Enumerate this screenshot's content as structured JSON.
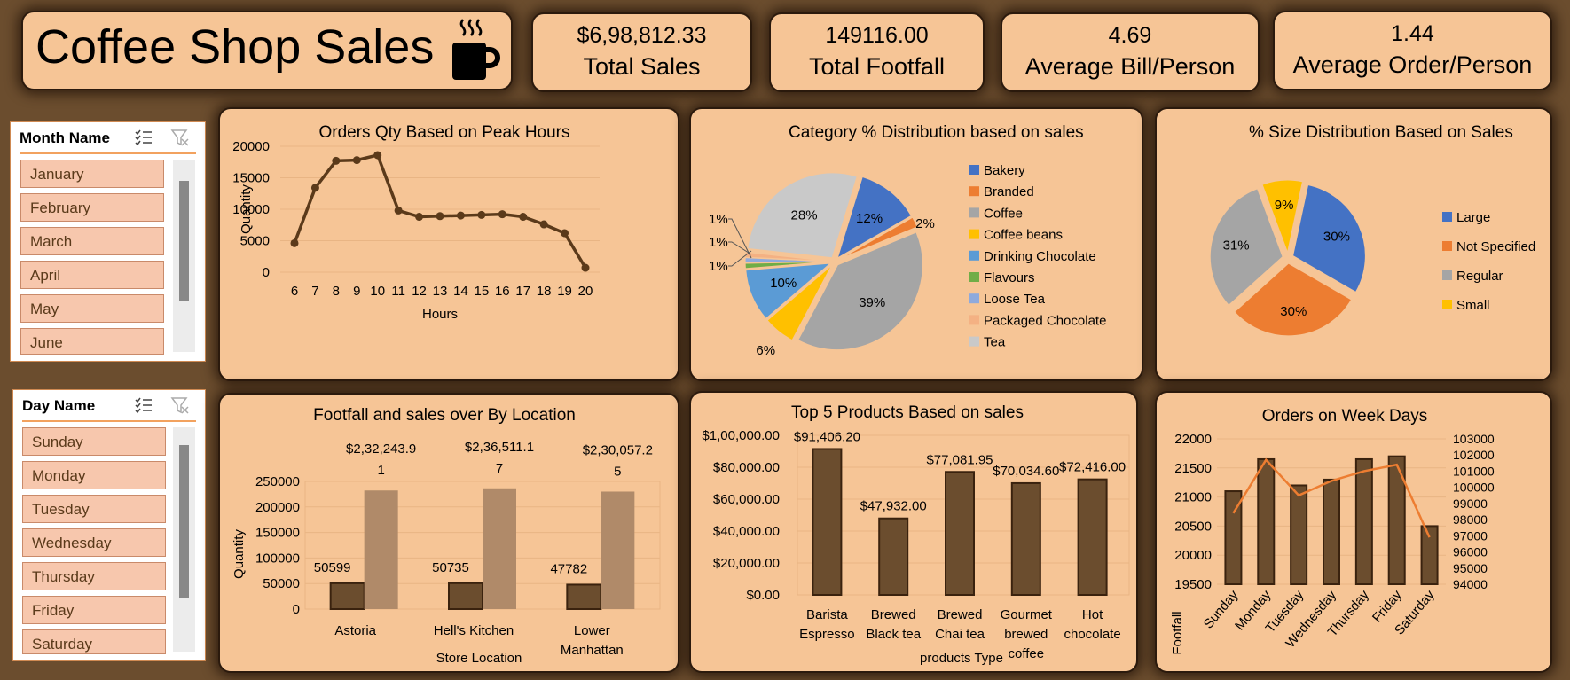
{
  "dashboard": {
    "title": "Coffee Shop Sales",
    "title_icon": "coffee-cup-icon"
  },
  "kpis": [
    {
      "value": "$6,98,812.33",
      "label": "Total Sales"
    },
    {
      "value": "149116.00",
      "label": "Total Footfall"
    },
    {
      "value": "4.69",
      "label": "Average Bill/Person"
    },
    {
      "value": "1.44",
      "label": "Average Order/Person"
    }
  ],
  "month_slicer": {
    "header": "Month Name",
    "items": [
      "January",
      "February",
      "March",
      "April",
      "May",
      "June"
    ],
    "icons": [
      "multi-select-icon",
      "clear-filter-icon"
    ]
  },
  "day_slicer": {
    "header": "Day Name",
    "items": [
      "Sunday",
      "Monday",
      "Tuesday",
      "Wednesday",
      "Thursday",
      "Friday",
      "Saturday"
    ],
    "icons": [
      "multi-select-icon",
      "clear-filter-icon"
    ]
  },
  "colors": {
    "background": "#6b4d2e",
    "card": "#f6c596",
    "bar_dark": "#6b4d2e",
    "bar_light": "#b08a69",
    "line_orange": "#ed7d31"
  },
  "chart_data": [
    {
      "id": "peak_hours",
      "type": "line",
      "title": "Orders Qty Based on Peak Hours",
      "xlabel": "Hours",
      "ylabel": "Quantity",
      "x": [
        6,
        7,
        8,
        9,
        10,
        11,
        12,
        13,
        14,
        15,
        16,
        17,
        18,
        19,
        20
      ],
      "values": [
        4600,
        13400,
        17700,
        17800,
        18600,
        9800,
        8800,
        8900,
        9000,
        9100,
        9200,
        8800,
        7600,
        6200,
        700
      ],
      "ylim": [
        0,
        20000
      ],
      "yticks": [
        "0",
        "5000",
        "10000",
        "15000",
        "20000"
      ],
      "grid": true
    },
    {
      "id": "category_pie",
      "type": "pie",
      "title": "Category  % Distribution based on sales",
      "categories": [
        "Bakery",
        "Branded",
        "Coffee",
        "Coffee beans",
        "Drinking Chocolate",
        "Flavours",
        "Loose Tea",
        "Packaged Chocolate",
        "Tea"
      ],
      "values": [
        12,
        2,
        39,
        6,
        10,
        1,
        1,
        1,
        28
      ],
      "labels": [
        "12%",
        "2%",
        "39%",
        "6%",
        "10%",
        "1%",
        "1%",
        "1%",
        "28%"
      ],
      "colors": [
        "#4472c4",
        "#ed7d31",
        "#a5a5a5",
        "#ffc000",
        "#5b9bd5",
        "#70ad47",
        "#8faadc",
        "#f4b183",
        "#c9c9c9"
      ],
      "legend": "right"
    },
    {
      "id": "size_pie",
      "type": "pie",
      "title": "% Size Distribution Based on Sales",
      "categories": [
        "Large",
        "Not Specified",
        "Regular",
        "Small"
      ],
      "values": [
        30,
        30,
        31,
        9
      ],
      "labels": [
        "30%",
        "30%",
        "31%",
        "9%"
      ],
      "colors": [
        "#4472c4",
        "#ed7d31",
        "#a5a5a5",
        "#ffc000"
      ],
      "legend": "right"
    },
    {
      "id": "location_bars",
      "type": "bar",
      "title": "Footfall  and sales  over By  Location",
      "xlabel": "Store  Location",
      "ylabel": "Quantity",
      "categories": [
        "Astoria",
        "Hell's Kitchen",
        "Lower Manhattan"
      ],
      "series": [
        {
          "values": [
            50599,
            50735,
            47782
          ],
          "labels": [
            "50599",
            "50735",
            "47782"
          ]
        },
        {
          "values": [
            232243.91,
            236511.17,
            230057.25
          ],
          "labels": [
            "$2,32,243.9\n1",
            "$2,36,511.1\n7",
            "$2,30,057.2\n5"
          ]
        }
      ],
      "ylim": [
        0,
        250000
      ],
      "yticks": [
        "0",
        "50000",
        "100000",
        "150000",
        "200000",
        "250000"
      ]
    },
    {
      "id": "top_products",
      "type": "bar",
      "title": "Top 5 Products Based on sales",
      "xlabel": "products Type",
      "categories": [
        "Barista Espresso",
        "Brewed Black tea",
        "Brewed Chai tea",
        "Gourmet brewed coffee",
        "Hot chocolate"
      ],
      "values": [
        91406.2,
        47932.0,
        77081.95,
        70034.6,
        72416.0
      ],
      "labels": [
        "$91,406.20",
        "$47,932.00",
        "$77,081.95",
        "$70,034.60",
        "$72,416.00"
      ],
      "ylim": [
        0,
        100000
      ],
      "yticks": [
        "$0.00",
        "$20,000.00",
        "$40,000.00",
        "$60,000.00",
        "$80,000.00",
        "$1,00,000.00"
      ]
    },
    {
      "id": "weekdays",
      "type": "bar",
      "title": "Orders on Week Days",
      "ylabel": "Footfall",
      "categories": [
        "Sunday",
        "Monday",
        "Tuesday",
        "Wednesday",
        "Thursday",
        "Friday",
        "Saturday"
      ],
      "series": [
        {
          "type": "bar",
          "values": [
            21100,
            21650,
            21200,
            21300,
            21650,
            21700,
            20500
          ]
        },
        {
          "type": "line",
          "axis": "right",
          "values": [
            98400,
            101700,
            99500,
            100400,
            101000,
            101400,
            96900
          ]
        }
      ],
      "ylim": [
        19500,
        22000
      ],
      "yticks": [
        "19500",
        "20000",
        "20500",
        "21000",
        "21500",
        "22000"
      ],
      "y2lim": [
        94000,
        103000
      ],
      "y2ticks": [
        "94000",
        "95000",
        "96000",
        "97000",
        "98000",
        "99000",
        "100000",
        "101000",
        "102000",
        "103000"
      ]
    }
  ]
}
